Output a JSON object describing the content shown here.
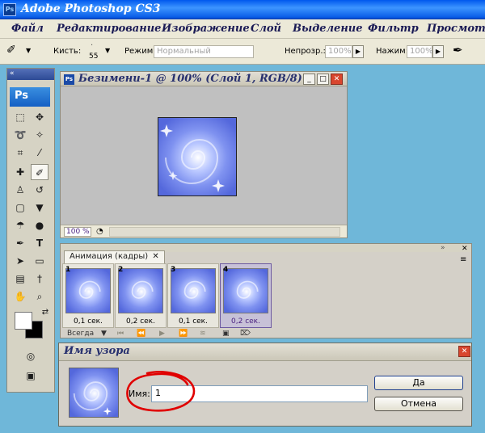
{
  "app": {
    "title": "Adobe Photoshop CS3",
    "logo": "Ps"
  },
  "menu": [
    "Файл",
    "Редактирование",
    "Изображение",
    "Слой",
    "Выделение",
    "Фильтр",
    "Просмотр"
  ],
  "options": {
    "brush_label": "Кисть:",
    "brush_size": "55",
    "mode_label": "Режим:",
    "mode_value": "Нормальный",
    "opacity_label": "Непрозр.:",
    "opacity_value": "100%",
    "pressure_label": "Нажим:",
    "pressure_value": "100%"
  },
  "toolbox": {
    "logo": "Ps"
  },
  "document": {
    "title": "Безимени-1 @ 100% (Слой 1, RGB/8)",
    "zoom": "100 %"
  },
  "animation": {
    "tab_label": "Анимация (кадры)",
    "loop": "Всегда",
    "frames": [
      {
        "num": "1",
        "delay": "0,1 сек.",
        "selected": false
      },
      {
        "num": "2",
        "delay": "0,2 сек.",
        "selected": false
      },
      {
        "num": "3",
        "delay": "0,1 сек.",
        "selected": false
      },
      {
        "num": "4",
        "delay": "0,2 сек.",
        "selected": true
      }
    ]
  },
  "dialog": {
    "title": "Имя узора",
    "name_label": "Имя:",
    "name_value": "1",
    "ok_label": "Да",
    "cancel_label": "Отмена"
  },
  "colors": {
    "background": "#6fb7d9",
    "title_blue": "#0a5ee8",
    "panel": "#d4d0c8",
    "annotation": "#e00000"
  }
}
